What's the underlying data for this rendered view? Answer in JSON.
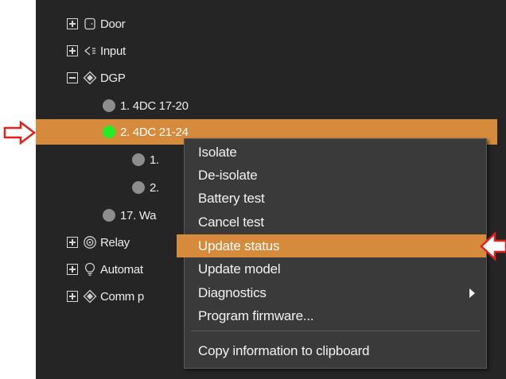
{
  "tree": {
    "door": "Door",
    "input": "Input",
    "dgp": "DGP",
    "dgp_child_1": "1. 4DC 17-20",
    "dgp_child_2": "2. 4DC 21-24",
    "sub_child_1": "1.",
    "sub_child_2": "2.",
    "dgp_child_17": "17. Wa",
    "relay": "Relay",
    "automation": "Automat",
    "comm": "Comm p"
  },
  "status_colors": {
    "online": "#22ee22",
    "unknown": "#8d8d8d",
    "selection": "#d68a3c",
    "callout_arrow": "#e0201c"
  },
  "context_menu": {
    "items": [
      {
        "label": "Isolate"
      },
      {
        "label": "De-isolate"
      },
      {
        "label": "Battery test"
      },
      {
        "label": "Cancel test"
      },
      {
        "label": "Update status",
        "highlighted": true
      },
      {
        "label": "Update model"
      },
      {
        "label": "Diagnostics",
        "has_submenu": true
      },
      {
        "label": "Program firmware..."
      },
      {
        "label": "Copy information to clipboard"
      }
    ]
  },
  "icons": {
    "door": "door-icon",
    "input": "input-icon",
    "dgp": "dgp-icon",
    "relay": "relay-icon",
    "automation": "bulb-icon",
    "comm": "comm-icon"
  }
}
